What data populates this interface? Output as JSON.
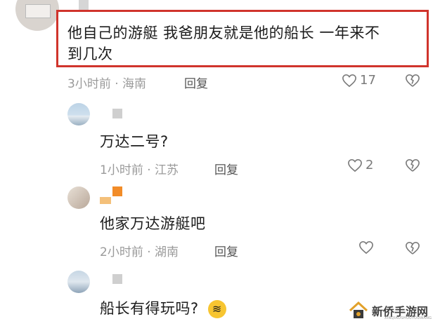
{
  "comments": [
    {
      "text_line1": "他自己的游艇 我爸朋友就是他的船长 一年来不",
      "text_line2": "到几次",
      "time": "3小时前",
      "location": "海南",
      "meta_sep": "·",
      "reply_label": "回复",
      "like_count": "17"
    },
    {
      "text": "万达二号?",
      "time": "1小时前",
      "location": "江苏",
      "meta_sep": "·",
      "reply_label": "回复",
      "like_count": "2"
    },
    {
      "text": "他家万达游艇吧",
      "time": "2小时前",
      "location": "湖南",
      "meta_sep": "·",
      "reply_label": "回复",
      "like_count": ""
    },
    {
      "text": "船长有得玩吗?",
      "emoji": "🤣"
    }
  ],
  "watermark": {
    "title": "新侨手游网",
    "subtitle": "XINQIAOSHOUYOUWANG"
  },
  "colors": {
    "highlight": "#d0342c",
    "meta": "#9a9a9a"
  },
  "icons": [
    "heart-icon",
    "broken-heart-icon",
    "laughing-emoji-icon"
  ]
}
